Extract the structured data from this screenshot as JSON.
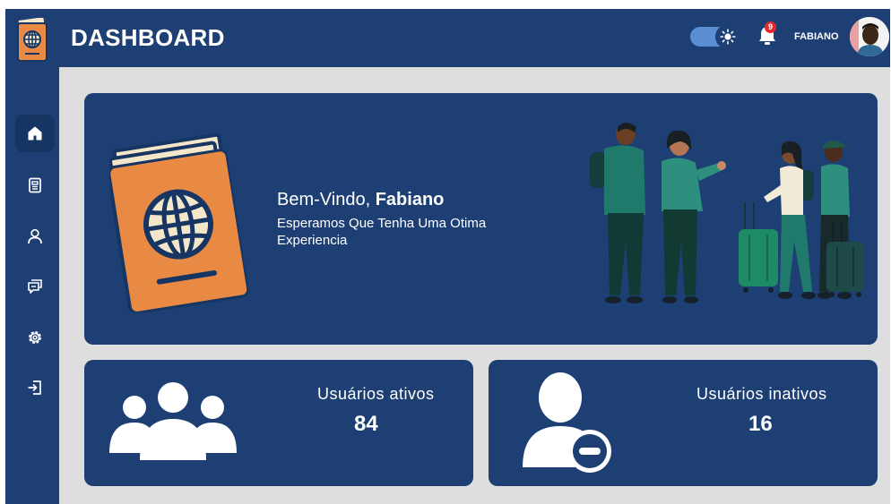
{
  "header": {
    "title": "DASHBOARD",
    "notification_count": "9",
    "username": "FABIANO",
    "theme_toggle": {
      "state": "on",
      "icon": "sun-icon"
    }
  },
  "sidebar": {
    "items": [
      {
        "id": "home",
        "icon": "home-icon",
        "active": true
      },
      {
        "id": "documents",
        "icon": "document-icon",
        "active": false
      },
      {
        "id": "users",
        "icon": "user-icon",
        "active": false
      },
      {
        "id": "messages",
        "icon": "chat-icon",
        "active": false
      },
      {
        "id": "settings",
        "icon": "gear-icon",
        "active": false
      },
      {
        "id": "logout",
        "icon": "logout-icon",
        "active": false
      }
    ]
  },
  "welcome": {
    "greeting": "Bem-Vindo,",
    "name": "Fabiano",
    "subtitle": "Esperamos Que Tenha Uma Otima Experiencia"
  },
  "stats": {
    "active": {
      "label": "Usuários ativos",
      "value": "84"
    },
    "inactive": {
      "label": "Usuários inativos",
      "value": "16"
    }
  },
  "colors": {
    "primary": "#1d3f74",
    "background": "#dedede",
    "accent_orange": "#e98a44",
    "toggle": "#5b8fd3",
    "badge": "#e3262a"
  }
}
